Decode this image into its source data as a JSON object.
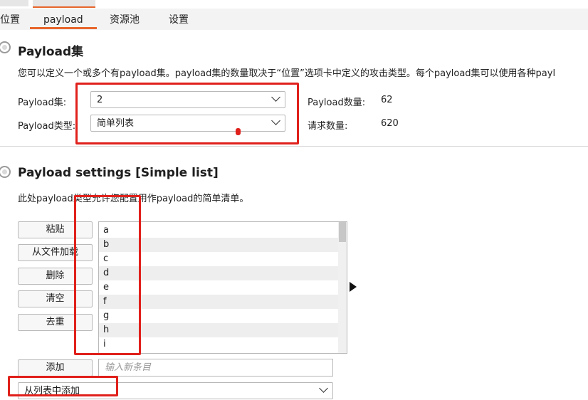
{
  "tabs": [
    {
      "label": "位置"
    },
    {
      "label": "payload"
    },
    {
      "label": "资源池"
    },
    {
      "label": "设置"
    }
  ],
  "payload_sets": {
    "title": "Payload集",
    "description": "您可以定义一个或多个有payload集。payload集的数量取决于“位置”选项卡中定义的攻击类型。每个payload集可以使用各种payl",
    "set_label": "Payload集:",
    "set_value": "2",
    "type_label": "Payload类型:",
    "type_value": "简单列表",
    "count_label": "Payload数量:",
    "count_value": "62",
    "request_label": "请求数量:",
    "request_value": "620"
  },
  "payload_settings": {
    "title": "Payload settings [Simple list]",
    "description": "此处payload类型允许您配置用作payload的简单清单。",
    "buttons": {
      "paste": "粘贴",
      "load": "从文件加载",
      "remove": "删除",
      "clear": "清空",
      "dedupe": "去重",
      "add": "添加"
    },
    "items": [
      "a",
      "b",
      "c",
      "d",
      "e",
      "f",
      "g",
      "h",
      "i"
    ],
    "add_placeholder": "输入新条目",
    "add_from_list": "从列表中添加"
  },
  "colors": {
    "accent": "#e8662c",
    "highlight": "#e0201b"
  }
}
